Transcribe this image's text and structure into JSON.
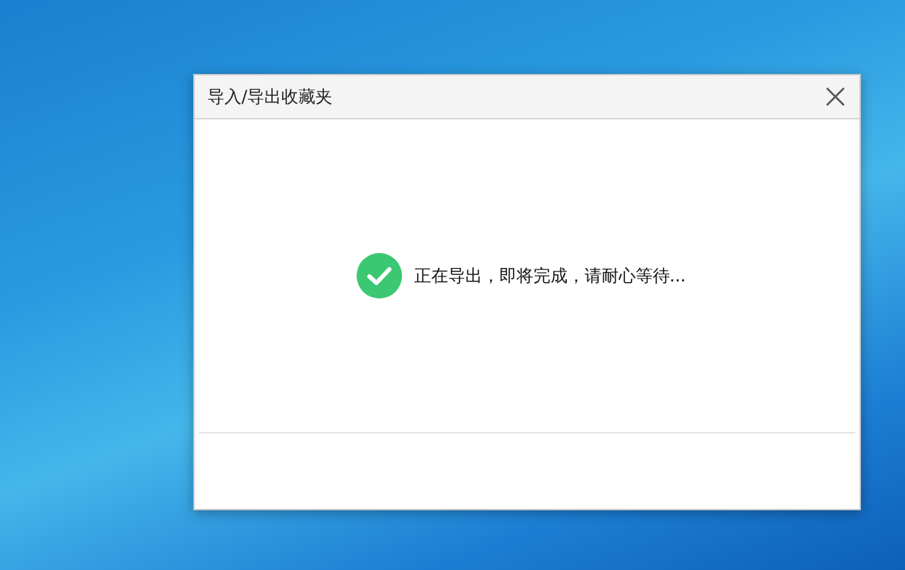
{
  "dialog": {
    "title": "导入/导出收藏夹",
    "message": "正在导出，即将完成，请耐心等待..."
  }
}
